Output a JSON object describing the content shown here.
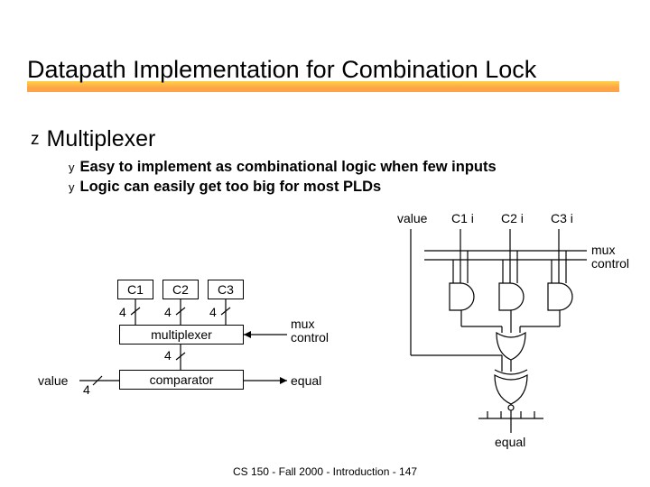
{
  "title": "Datapath Implementation for Combination Lock",
  "main_bullet": "Multiplexer",
  "sub_bullets": [
    "Easy to implement as combinational logic when few inputs",
    "Logic can easily get too big for most PLDs"
  ],
  "left_diagram": {
    "c1": "C1",
    "c2": "C2",
    "c3": "C3",
    "bus_width": "4",
    "mux_box": "multiplexer",
    "cmp_box": "comparator",
    "mux_control": "mux\ncontrol",
    "value_label": "value",
    "equal_label": "equal"
  },
  "right_diagram": {
    "value": "value",
    "c1i": "C1 i",
    "c2i": "C2 i",
    "c3i": "C3 i",
    "mux_control": "mux\ncontrol",
    "equal": "equal"
  },
  "footer": "CS 150 - Fall 2000 - Introduction - 147"
}
